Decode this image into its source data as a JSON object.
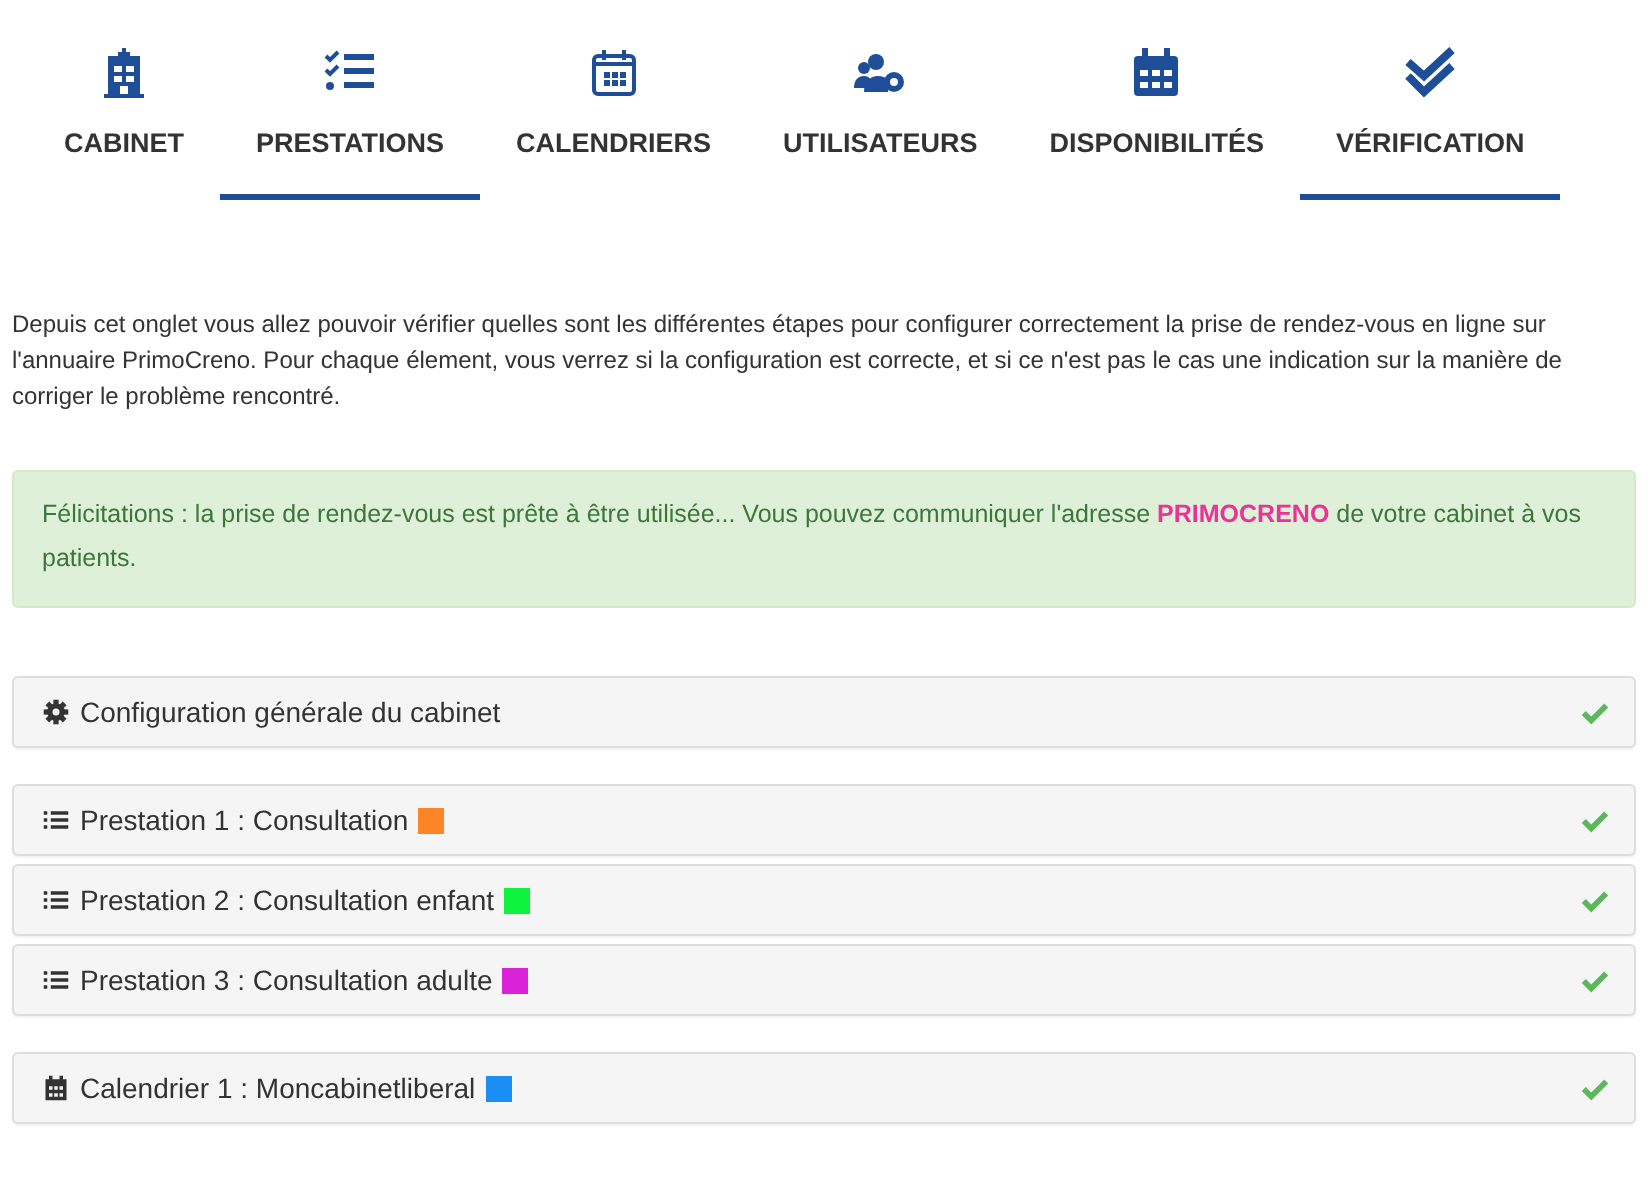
{
  "tabs": [
    {
      "label": "CABINET",
      "kind": "building",
      "selected": false
    },
    {
      "label": "PRESTATIONS",
      "kind": "checklist",
      "selected": true
    },
    {
      "label": "CALENDRIERS",
      "kind": "calendaroutline",
      "selected": false
    },
    {
      "label": "UTILISATEURS",
      "kind": "usersgear",
      "selected": false
    },
    {
      "label": "DISPONIBILITÉS",
      "kind": "calendar",
      "selected": false
    },
    {
      "label": "VÉRIFICATION",
      "kind": "doublecheck",
      "selected": true
    }
  ],
  "intro": "Depuis cet onglet vous allez pouvoir vérifier quelles sont les différentes étapes pour configurer correctement la prise de rendez-vous en ligne sur l'annuaire PrimoCreno. Pour chaque élement, vous verrez si la configuration est correcte, et si ce n'est pas le cas une indication sur la manière de corriger le problème rencontré.",
  "alert": {
    "before": "Félicitations : la prise de rendez-vous est prête à être utilisée... Vous pouvez communiquer l'adresse ",
    "highlight": "PRIMOCRENO",
    "after": " de votre cabinet à vos patients."
  },
  "groups": [
    [
      {
        "kind": "config",
        "label": "Configuration générale du cabinet",
        "ok": true
      }
    ],
    [
      {
        "kind": "prestation",
        "label": "Prestation 1 : Consultation",
        "color": "#fd8526",
        "ok": true
      },
      {
        "kind": "prestation",
        "label": "Prestation 2 : Consultation enfant",
        "color": "#0cf53c",
        "ok": true
      },
      {
        "kind": "prestation",
        "label": "Prestation 3 : Consultation adulte",
        "color": "#da22d8",
        "ok": true
      }
    ],
    [
      {
        "kind": "calendar",
        "label": "Calendrier 1 : Moncabinetliberal",
        "color": "#1a8ef5",
        "ok": true
      }
    ]
  ]
}
